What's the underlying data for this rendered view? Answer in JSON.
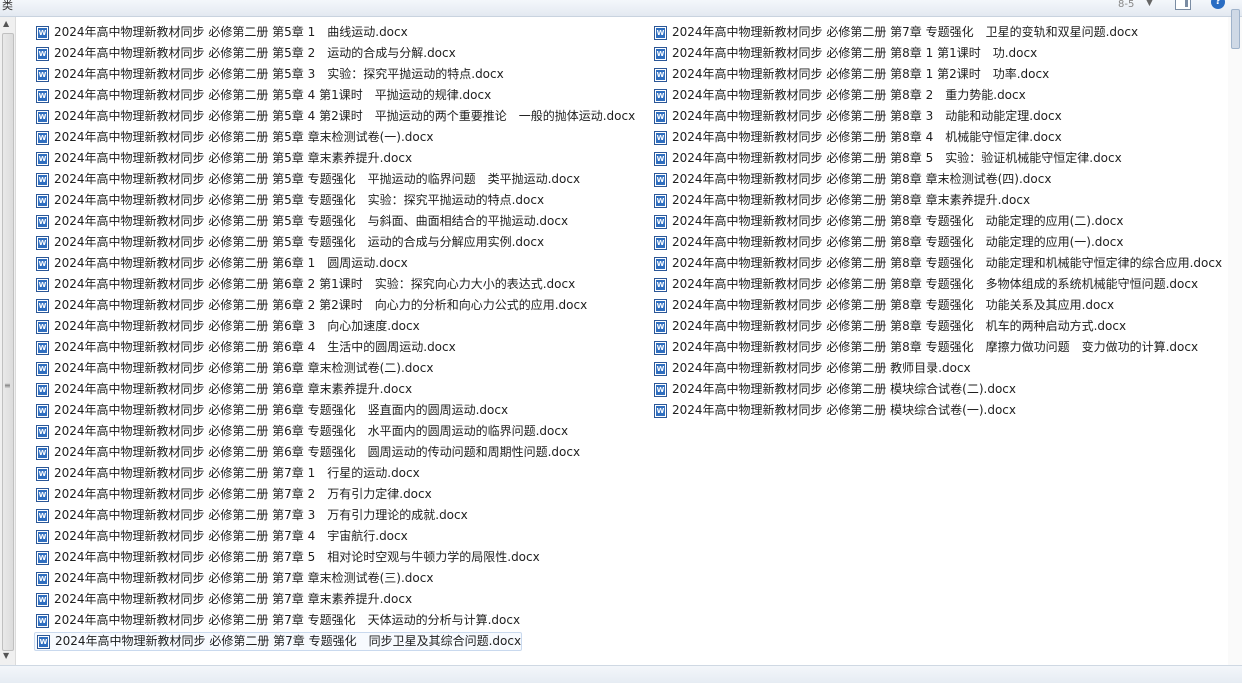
{
  "toolbar": {
    "menu_stub": "类",
    "view_slider": "8-5",
    "view_arrow": "▼",
    "help_label": "?"
  },
  "files": [
    {
      "name": "2024年高中物理新教材同步 必修第二册  第5章 1　曲线运动.docx"
    },
    {
      "name": "2024年高中物理新教材同步 必修第二册  第5章 2　运动的合成与分解.docx"
    },
    {
      "name": "2024年高中物理新教材同步 必修第二册  第5章 3　实验：探究平抛运动的特点.docx"
    },
    {
      "name": "2024年高中物理新教材同步 必修第二册  第5章 4 第1课时　平抛运动的规律.docx"
    },
    {
      "name": "2024年高中物理新教材同步 必修第二册  第5章 4 第2课时　平抛运动的两个重要推论　一般的抛体运动.docx"
    },
    {
      "name": "2024年高中物理新教材同步 必修第二册  第5章 章末检测试卷(一).docx"
    },
    {
      "name": "2024年高中物理新教材同步 必修第二册  第5章 章末素养提升.docx"
    },
    {
      "name": "2024年高中物理新教材同步 必修第二册  第5章 专题强化　平抛运动的临界问题　类平抛运动.docx"
    },
    {
      "name": "2024年高中物理新教材同步 必修第二册  第5章 专题强化　实验：探究平抛运动的特点.docx"
    },
    {
      "name": "2024年高中物理新教材同步 必修第二册  第5章 专题强化　与斜面、曲面相结合的平抛运动.docx"
    },
    {
      "name": "2024年高中物理新教材同步 必修第二册  第5章 专题强化　运动的合成与分解应用实例.docx"
    },
    {
      "name": "2024年高中物理新教材同步 必修第二册  第6章 1　圆周运动.docx"
    },
    {
      "name": "2024年高中物理新教材同步 必修第二册  第6章 2 第1课时　实验：探究向心力大小的表达式.docx"
    },
    {
      "name": "2024年高中物理新教材同步 必修第二册  第6章 2 第2课时　向心力的分析和向心力公式的应用.docx"
    },
    {
      "name": "2024年高中物理新教材同步 必修第二册  第6章 3　向心加速度.docx"
    },
    {
      "name": "2024年高中物理新教材同步 必修第二册  第6章 4　生活中的圆周运动.docx"
    },
    {
      "name": "2024年高中物理新教材同步 必修第二册  第6章 章末检测试卷(二).docx"
    },
    {
      "name": "2024年高中物理新教材同步 必修第二册  第6章 章末素养提升.docx"
    },
    {
      "name": "2024年高中物理新教材同步 必修第二册  第6章 专题强化　竖直面内的圆周运动.docx"
    },
    {
      "name": "2024年高中物理新教材同步 必修第二册  第6章 专题强化　水平面内的圆周运动的临界问题.docx"
    },
    {
      "name": "2024年高中物理新教材同步 必修第二册  第6章 专题强化　圆周运动的传动问题和周期性问题.docx"
    },
    {
      "name": "2024年高中物理新教材同步 必修第二册  第7章 1　行星的运动.docx"
    },
    {
      "name": "2024年高中物理新教材同步 必修第二册  第7章 2　万有引力定律.docx"
    },
    {
      "name": "2024年高中物理新教材同步 必修第二册  第7章 3　万有引力理论的成就.docx"
    },
    {
      "name": "2024年高中物理新教材同步 必修第二册  第7章 4　宇宙航行.docx"
    },
    {
      "name": "2024年高中物理新教材同步 必修第二册  第7章 5　相对论时空观与牛顿力学的局限性.docx"
    },
    {
      "name": "2024年高中物理新教材同步 必修第二册  第7章 章末检测试卷(三).docx"
    },
    {
      "name": "2024年高中物理新教材同步 必修第二册  第7章 章末素养提升.docx"
    },
    {
      "name": "2024年高中物理新教材同步 必修第二册  第7章 专题强化　天体运动的分析与计算.docx"
    },
    {
      "name": "2024年高中物理新教材同步 必修第二册  第7章 专题强化　同步卫星及其综合问题.docx",
      "selected": true
    },
    {
      "name": "2024年高中物理新教材同步 必修第二册  第7章 专题强化　卫星的变轨和双星问题.docx"
    },
    {
      "name": "2024年高中物理新教材同步 必修第二册  第8章 1 第1课时　功.docx"
    },
    {
      "name": "2024年高中物理新教材同步 必修第二册  第8章 1 第2课时　功率.docx"
    },
    {
      "name": "2024年高中物理新教材同步 必修第二册  第8章 2　重力势能.docx"
    },
    {
      "name": "2024年高中物理新教材同步 必修第二册  第8章 3　动能和动能定理.docx"
    },
    {
      "name": "2024年高中物理新教材同步 必修第二册  第8章 4　机械能守恒定律.docx"
    },
    {
      "name": "2024年高中物理新教材同步 必修第二册  第8章 5　实验：验证机械能守恒定律.docx"
    },
    {
      "name": "2024年高中物理新教材同步 必修第二册  第8章 章末检测试卷(四).docx"
    },
    {
      "name": "2024年高中物理新教材同步 必修第二册  第8章 章末素养提升.docx"
    },
    {
      "name": "2024年高中物理新教材同步 必修第二册  第8章 专题强化　动能定理的应用(二).docx"
    },
    {
      "name": "2024年高中物理新教材同步 必修第二册  第8章 专题强化　动能定理的应用(一).docx"
    },
    {
      "name": "2024年高中物理新教材同步 必修第二册  第8章 专题强化　动能定理和机械能守恒定律的综合应用.docx"
    },
    {
      "name": "2024年高中物理新教材同步 必修第二册  第8章 专题强化　多物体组成的系统机械能守恒问题.docx"
    },
    {
      "name": "2024年高中物理新教材同步 必修第二册  第8章 专题强化　功能关系及其应用.docx"
    },
    {
      "name": "2024年高中物理新教材同步 必修第二册  第8章 专题强化　机车的两种启动方式.docx"
    },
    {
      "name": "2024年高中物理新教材同步 必修第二册  第8章 专题强化　摩擦力做功问题　变力做功的计算.docx"
    },
    {
      "name": "2024年高中物理新教材同步 必修第二册  教师目录.docx"
    },
    {
      "name": "2024年高中物理新教材同步 必修第二册  模块综合试卷(二).docx"
    },
    {
      "name": "2024年高中物理新教材同步 必修第二册  模块综合试卷(一).docx"
    }
  ]
}
